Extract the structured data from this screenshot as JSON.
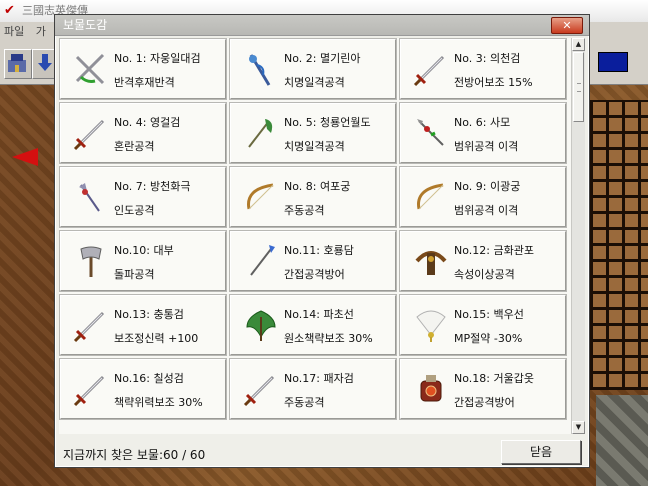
{
  "app": {
    "title": "三國志英傑傳",
    "menu": [
      "파일",
      "가"
    ]
  },
  "dialog": {
    "title": "보물도감",
    "close_label": "✕",
    "status_text": "지금까지 찾은 보물:60 / 60",
    "confirm_label": "닫음"
  },
  "treasures": [
    {
      "name": "No. 1: 자웅일대검",
      "effect": "반격후재반격",
      "icon": "twin-swords-icon"
    },
    {
      "name": "No. 2: 멸기린아",
      "effect": "치명일격공격",
      "icon": "dragon-spear-icon"
    },
    {
      "name": "No. 3: 의천검",
      "effect": "전방어보조 15%",
      "icon": "sword-icon"
    },
    {
      "name": "No. 4: 영걸검",
      "effect": "혼란공격",
      "icon": "sword-icon"
    },
    {
      "name": "No. 5: 청룡언월도",
      "effect": "치명일격공격",
      "icon": "glaive-icon"
    },
    {
      "name": "No. 6: 사모",
      "effect": "범위공격 이격",
      "icon": "serpent-spear-icon"
    },
    {
      "name": "No. 7: 방천화극",
      "effect": "인도공격",
      "icon": "halberd-icon"
    },
    {
      "name": "No. 8: 여포궁",
      "effect": "주동공격",
      "icon": "bow-icon"
    },
    {
      "name": "No. 9: 이광궁",
      "effect": "범위공격 이격",
      "icon": "bow-icon"
    },
    {
      "name": "No.10: 대부",
      "effect": "돌파공격",
      "icon": "axe-icon"
    },
    {
      "name": "No.11: 호룡담",
      "effect": "간접공격방어",
      "icon": "spear-icon"
    },
    {
      "name": "No.12: 금화관포",
      "effect": "속성이상공격",
      "icon": "crossbow-icon"
    },
    {
      "name": "No.13: 충통검",
      "effect": "보조정신력 +100",
      "icon": "sword-icon"
    },
    {
      "name": "No.14: 파초선",
      "effect": "원소책략보조 30%",
      "icon": "leaf-fan-icon"
    },
    {
      "name": "No.15: 백우선",
      "effect": "MP절약 -30%",
      "icon": "feather-fan-icon"
    },
    {
      "name": "No.16: 칠성검",
      "effect": "책략위력보조 30%",
      "icon": "sword-icon"
    },
    {
      "name": "No.17: 패자검",
      "effect": "주동공격",
      "icon": "sword-icon"
    },
    {
      "name": "No.18: 거울갑옷",
      "effect": "간접공격방어",
      "icon": "armor-icon"
    }
  ]
}
